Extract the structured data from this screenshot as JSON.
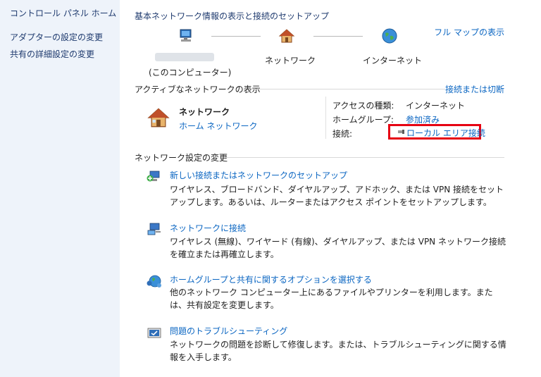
{
  "sidebar": {
    "home": "コントロール パネル ホーム",
    "links": [
      "アダプターの設定の変更",
      "共有の詳細設定の変更"
    ]
  },
  "main": {
    "title": "基本ネットワーク情報の表示と接続のセットアップ",
    "full_map": "フル マップの表示",
    "map": {
      "computer_label": "(このコンピューター)",
      "network_label": "ネットワーク",
      "internet_label": "インターネット"
    },
    "active": {
      "heading": "アクティブなネットワークの表示",
      "connect_disconnect": "接続または切断",
      "network_name": "ネットワーク",
      "network_type": "ホーム ネットワーク",
      "access_type_label": "アクセスの種類:",
      "access_type_value": "インターネット",
      "homegroup_label": "ホームグループ:",
      "homegroup_value": "参加済み",
      "connection_label": "接続:",
      "connection_value": "ローカル エリア接続"
    },
    "settings": {
      "heading": "ネットワーク設定の変更",
      "tasks": [
        {
          "title": "新しい接続またはネットワークのセットアップ",
          "desc": "ワイヤレス、ブロードバンド、ダイヤルアップ、アドホック、または VPN 接続をセットアップします。あるいは、ルーターまたはアクセス ポイントをセットアップします。"
        },
        {
          "title": "ネットワークに接続",
          "desc": "ワイヤレス (無線)、ワイヤード (有線)、ダイヤルアップ、または VPN ネットワーク接続を確立または再確立します。"
        },
        {
          "title": "ホームグループと共有に関するオプションを選択する",
          "desc": "他のネットワーク コンピューター上にあるファイルやプリンターを利用します。または、共有設定を変更します。"
        },
        {
          "title": "問題のトラブルシューティング",
          "desc": "ネットワークの問題を診断して修復します。または、トラブルシューティングに関する情報を入手します。"
        }
      ]
    }
  },
  "colors": {
    "sidebar_bg": "#eef3fa",
    "link": "#0b66c2",
    "highlight_box": "#e60012"
  }
}
